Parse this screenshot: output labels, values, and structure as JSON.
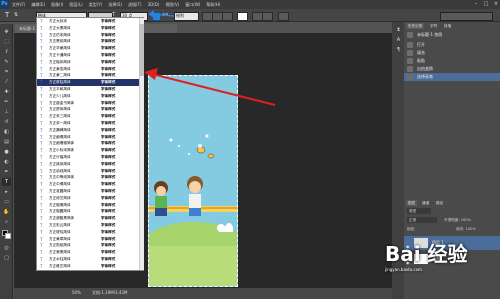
{
  "app": {
    "logo": "Ps"
  },
  "menu": [
    "文件(F)",
    "编辑(E)",
    "图像(I)",
    "图层(L)",
    "类型(Y)",
    "选择(S)",
    "滤镜(T)",
    "3D(D)",
    "视图(V)",
    "窗口(W)",
    "帮助(H)"
  ],
  "options": {
    "font_family_value": "楷体",
    "font_size_value": "30 点",
    "anti_alias": "锐利"
  },
  "document": {
    "tab_title": "未标题-1 @ 50%(图层 1, RGB/8) *",
    "zoom": "50%",
    "doc_info": "文档:1.19M/3.43M"
  },
  "font_list": {
    "selected_index": 9,
    "items": [
      {
        "name": "方正大标宋",
        "preview": "字体样式"
      },
      {
        "name": "方正大黑简体",
        "preview": "字体样式"
      },
      {
        "name": "方正仿宋简体",
        "preview": "字体样式"
      },
      {
        "name": "方正黑体简体",
        "preview": "字体样式"
      },
      {
        "name": "方正华隶简体",
        "preview": "字体样式"
      },
      {
        "name": "方正卡通简体",
        "preview": "字体样式"
      },
      {
        "name": "方正楷体简体",
        "preview": "字体样式"
      },
      {
        "name": "方正隶变简体",
        "preview": "字体样式"
      },
      {
        "name": "方正隶二简体",
        "preview": "字体样式"
      },
      {
        "name": "方正胖娃简体",
        "preview": "字体样式"
      },
      {
        "name": "方正平和简体",
        "preview": "字体样式"
      },
      {
        "name": "方正少儿简体",
        "preview": "字体样式"
      },
      {
        "name": "方正瘦金书简体",
        "preview": "字体样式"
      },
      {
        "name": "方正舒体简体",
        "preview": "字体样式"
      },
      {
        "name": "方正宋三简体",
        "preview": "字体样式"
      },
      {
        "name": "方正宋一简体",
        "preview": "字体样式"
      },
      {
        "name": "方正魏碑简体",
        "preview": "字体样式"
      },
      {
        "name": "方正细倩简体",
        "preview": "字体样式"
      },
      {
        "name": "方正细珊瑚简体",
        "preview": "字体样式"
      },
      {
        "name": "方正小标宋简体",
        "preview": "字体样式"
      },
      {
        "name": "方正行楷简体",
        "preview": "字体样式"
      },
      {
        "name": "方正姚体简体",
        "preview": "字体样式"
      },
      {
        "name": "方正幼线简体",
        "preview": "字体样式"
      },
      {
        "name": "方正中等线简体",
        "preview": "字体样式"
      },
      {
        "name": "方正中倩简体",
        "preview": "字体样式"
      },
      {
        "name": "方正准圆简体",
        "preview": "字体样式"
      },
      {
        "name": "方正综艺简体",
        "preview": "字体样式"
      },
      {
        "name": "方正粗倩简体",
        "preview": "字体样式"
      },
      {
        "name": "方正粗圆简体",
        "preview": "字体样式"
      },
      {
        "name": "方正超粗黑简体",
        "preview": "字体样式"
      },
      {
        "name": "方正彩云简体",
        "preview": "字体样式"
      },
      {
        "name": "方正琥珀简体",
        "preview": "字体样式"
      },
      {
        "name": "方正黄草简体",
        "preview": "字体样式"
      },
      {
        "name": "方正剪纸简体",
        "preview": "字体样式"
      },
      {
        "name": "方正美黑简体",
        "preview": "字体样式"
      },
      {
        "name": "方正水柱简体",
        "preview": "字体样式"
      },
      {
        "name": "方正稚艺简体",
        "preview": "字体样式"
      }
    ]
  },
  "panels": {
    "top_tabs": [
      "历史记录",
      "字符",
      "段落"
    ],
    "history_items": [
      "未标题-1 快照",
      "打开",
      "填充",
      "粘贴",
      "自由变换",
      "选择画笔"
    ],
    "layers_tabs": [
      "图层",
      "通道",
      "路径"
    ],
    "layer_filter": "类型",
    "blend_mode": "正常",
    "opacity_label": "不透明度: 100%",
    "lock_label": "锁定:",
    "fill_label": "填充: 100%",
    "layers": [
      "图层 1",
      "背景"
    ]
  },
  "watermark": {
    "text": "Bai 经验",
    "url": "jingyan.baidu.com"
  },
  "colors": {
    "accent": "#2d7fd8",
    "selection": "#23346a",
    "arrow": "#e02020"
  }
}
